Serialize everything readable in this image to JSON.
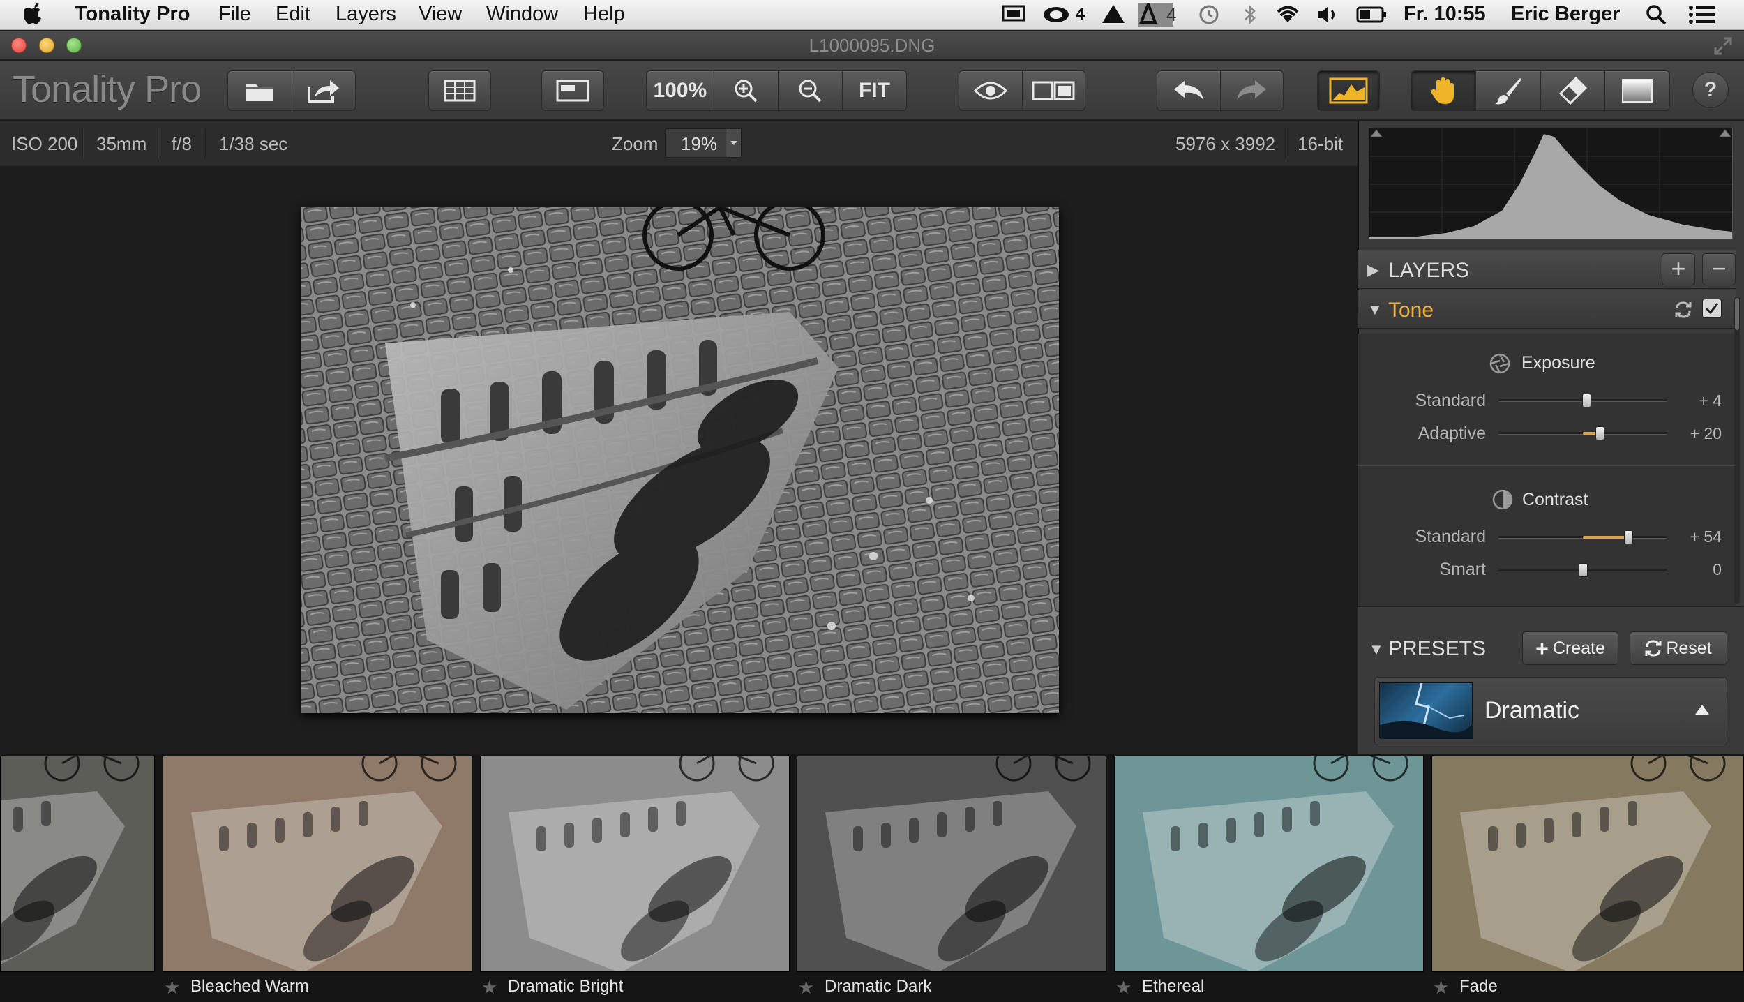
{
  "menubar": {
    "app_name": "Tonality Pro",
    "menus": [
      "File",
      "Edit",
      "Layers",
      "View",
      "Window",
      "Help"
    ],
    "status_badge_1": "4",
    "status_badge_2": "4",
    "clock": "Fr. 10:55",
    "user": "Eric Berger"
  },
  "window": {
    "title": "L1000095.DNG"
  },
  "toolbar": {
    "brand": "Tonality Pro",
    "zoom_100": "100%",
    "fit": "FIT",
    "help": "?"
  },
  "info": {
    "iso": "ISO 200",
    "focal": "35mm",
    "aperture": "f/8",
    "shutter": "1/38 sec",
    "zoom_label": "Zoom",
    "zoom_value": "19%",
    "dimensions": "5976 x 3992",
    "bitdepth": "16-bit"
  },
  "panel": {
    "layers_label": "LAYERS",
    "tone_label": "Tone",
    "exposure_title": "Exposure",
    "contrast_title": "Contrast",
    "sliders": [
      {
        "label": "Standard",
        "value": "+ 4",
        "level": 0.52
      },
      {
        "label": "Adaptive",
        "value": "+ 20",
        "level": 0.6
      },
      {
        "label": "Standard",
        "value": "+ 54",
        "level": 0.77
      },
      {
        "label": "Smart",
        "value": "0",
        "level": 0.5
      }
    ],
    "presets_label": "PRESETS",
    "create_label": "Create",
    "reset_label": "Reset",
    "preset_category": "Dramatic"
  },
  "filmstrip": {
    "items": [
      {
        "label": "",
        "tint": "#5d5d58"
      },
      {
        "label": "Bleached Warm",
        "tint": "#8f7a6a"
      },
      {
        "label": "Dramatic Bright",
        "tint": "#8c8c8c"
      },
      {
        "label": "Dramatic Dark",
        "tint": "#505050"
      },
      {
        "label": "Ethereal",
        "tint": "#6f9696"
      },
      {
        "label": "Fade",
        "tint": "#857a60"
      }
    ]
  },
  "colors": {
    "accent": "#f0b429",
    "tone_header": "#f0b040",
    "slider_fill": "#d8a64a"
  }
}
